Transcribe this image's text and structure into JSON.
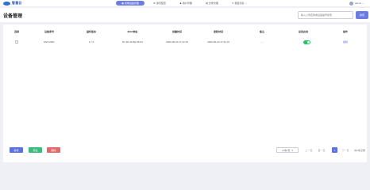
{
  "app": {
    "name": "智慧云"
  },
  "nav": [
    {
      "label": "终端设备管理",
      "icon": "device-icon",
      "active": true
    },
    {
      "label": "通讯配置",
      "icon": "settings-icon",
      "active": false
    },
    {
      "label": "用户管理",
      "icon": "user-icon",
      "active": false
    },
    {
      "label": "文件管理",
      "icon": "file-icon",
      "active": false
    },
    {
      "label": "便签列表",
      "icon": "note-icon",
      "active": false
    }
  ],
  "user": {
    "name": "admin"
  },
  "page": {
    "title": "设备管理",
    "search_placeholder": "输入公司名称或设备编号搜索",
    "search_button": "搜索"
  },
  "table": {
    "headers": [
      "选择",
      "设备序号",
      "固件版本",
      "MAC地址",
      "创建时间",
      "更新时间",
      "备注",
      "是否启用",
      "操作"
    ],
    "rows": [
      {
        "device_no": "DEV-0001",
        "firmware": "1.7.3",
        "mac": "8C:1E:4A:B2:05:D1",
        "created": "2020-06-20 17:32:16",
        "updated": "2020-06-20 17:32:16",
        "remark": "- -",
        "enabled": true,
        "action": "编辑"
      }
    ]
  },
  "actions": {
    "add": "新增",
    "export": "导出",
    "delete": "删除"
  },
  "pagination": {
    "page_size": "10条/页",
    "prev": "上一页",
    "first": "首一页",
    "current_page": "1",
    "next": "下一页",
    "total": "共1条记录"
  },
  "colors": {
    "accent": "#6b7de0",
    "success": "#3dbb7d",
    "danger": "#e46a6a"
  }
}
